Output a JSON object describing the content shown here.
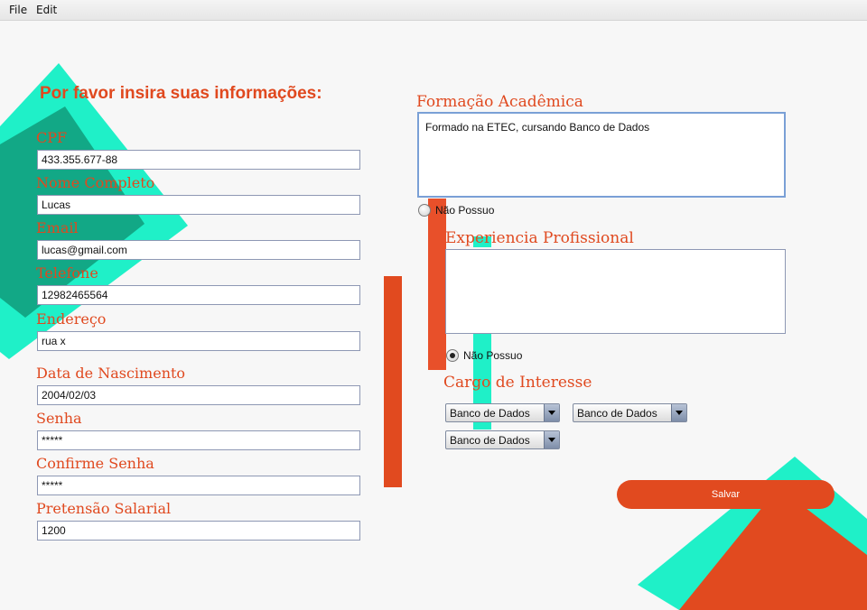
{
  "menu": [
    "File",
    "Edit"
  ],
  "colors": {
    "accent": "#e14a1f",
    "teal": "#1ff0c8",
    "dark_teal": "#12a886",
    "background": "#f7f7f7"
  },
  "heading": "Por favor insira suas informações:",
  "fields": [
    {
      "label": "CPF",
      "value": "433.355.677-88"
    },
    {
      "label": "Nome Completo",
      "value": "Lucas"
    },
    {
      "label": "Email",
      "value": "lucas@gmail.com"
    },
    {
      "label": "Telefone",
      "value": "12982465564"
    },
    {
      "label": "Endereço",
      "value": "rua x"
    },
    {
      "label": "Data de Nascimento",
      "value": "2004/02/03"
    },
    {
      "label": "Senha",
      "value": "*****"
    },
    {
      "label": "Confirme Senha",
      "value": "*****"
    },
    {
      "label": "Pretensão Salarial",
      "value": "1200"
    }
  ],
  "education": {
    "label": "Formação Acadêmica",
    "value": "Formado na ETEC, cursando Banco de Dados",
    "none_option": {
      "label": "Não Possuo",
      "checked": false
    }
  },
  "experience": {
    "label": "Experiencia Profissional",
    "value": "",
    "none_option": {
      "label": "Não Possuo",
      "checked": true
    }
  },
  "interest": {
    "label": "Cargo de Interesse",
    "selects": [
      "Banco de Dados",
      "Banco de Dados",
      "Banco de Dados"
    ]
  },
  "save_label": "Salvar"
}
